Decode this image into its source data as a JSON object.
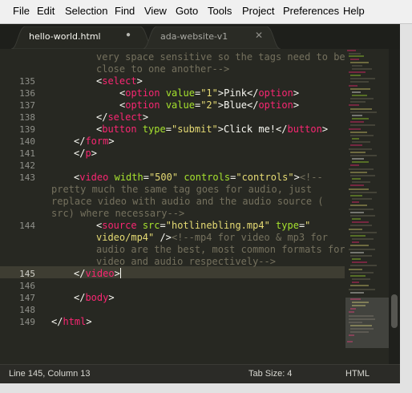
{
  "menu": [
    "File",
    "Edit",
    "Selection",
    "Find",
    "View",
    "Goto",
    "Tools",
    "Project",
    "Preferences",
    "Help"
  ],
  "tabs": [
    {
      "label": "hello-world.html",
      "state": "modified-dot"
    },
    {
      "label": "ada-website-v1",
      "state": "close-icon"
    }
  ],
  "tab_controls": {
    "modified": "●",
    "close": "✕"
  },
  "line_numbers": [
    "",
    "",
    "135",
    "136",
    "137",
    "138",
    "139",
    "140",
    "141",
    "142",
    "143",
    "",
    "",
    "",
    "144",
    "",
    "",
    "",
    "145",
    "146",
    "147",
    "148",
    "149"
  ],
  "code": [
    [
      {
        "c": "c",
        "x": "very space sensitive so the tags need to be"
      }
    ],
    [
      {
        "c": "c",
        "x": "close to one another-->"
      }
    ],
    [
      {
        "c": "p",
        "x": "<"
      },
      {
        "c": "t",
        "x": "select"
      },
      {
        "c": "p",
        "x": ">"
      }
    ],
    [
      {
        "c": "p",
        "x": "<"
      },
      {
        "c": "t",
        "x": "option"
      },
      {
        "c": "p",
        "x": " "
      },
      {
        "c": "a",
        "x": "value"
      },
      {
        "c": "p",
        "x": "="
      },
      {
        "c": "s",
        "x": "\"1\""
      },
      {
        "c": "p",
        "x": ">Pink</"
      },
      {
        "c": "t",
        "x": "option"
      },
      {
        "c": "p",
        "x": ">"
      }
    ],
    [
      {
        "c": "p",
        "x": "<"
      },
      {
        "c": "t",
        "x": "option"
      },
      {
        "c": "p",
        "x": " "
      },
      {
        "c": "a",
        "x": "value"
      },
      {
        "c": "p",
        "x": "="
      },
      {
        "c": "s",
        "x": "\"2\""
      },
      {
        "c": "p",
        "x": ">Blue</"
      },
      {
        "c": "t",
        "x": "option"
      },
      {
        "c": "p",
        "x": ">"
      }
    ],
    [
      {
        "c": "p",
        "x": "</"
      },
      {
        "c": "t",
        "x": "select"
      },
      {
        "c": "p",
        "x": ">"
      }
    ],
    [
      {
        "c": "p",
        "x": "<"
      },
      {
        "c": "t",
        "x": "button"
      },
      {
        "c": "p",
        "x": " "
      },
      {
        "c": "a",
        "x": "type"
      },
      {
        "c": "p",
        "x": "="
      },
      {
        "c": "s",
        "x": "\"submit\""
      },
      {
        "c": "p",
        "x": ">Click me!</"
      },
      {
        "c": "t",
        "x": "button"
      },
      {
        "c": "p",
        "x": ">"
      }
    ],
    [
      {
        "c": "p",
        "x": "</"
      },
      {
        "c": "t",
        "x": "form"
      },
      {
        "c": "p",
        "x": ">"
      }
    ],
    [
      {
        "c": "p",
        "x": "</"
      },
      {
        "c": "t",
        "x": "p"
      },
      {
        "c": "p",
        "x": ">"
      }
    ],
    [],
    [
      {
        "c": "p",
        "x": "<"
      },
      {
        "c": "t",
        "x": "video"
      },
      {
        "c": "p",
        "x": " "
      },
      {
        "c": "a",
        "x": "width"
      },
      {
        "c": "p",
        "x": "="
      },
      {
        "c": "s",
        "x": "\"500\""
      },
      {
        "c": "p",
        "x": " "
      },
      {
        "c": "a",
        "x": "controls"
      },
      {
        "c": "p",
        "x": "="
      },
      {
        "c": "s",
        "x": "\"controls\""
      },
      {
        "c": "p",
        "x": ">"
      },
      {
        "c": "c",
        "x": "<!--"
      }
    ],
    [
      {
        "c": "c",
        "x": "pretty much the same tag goes for audio, just"
      }
    ],
    [
      {
        "c": "c",
        "x": "replace video with audio and the audio source ("
      }
    ],
    [
      {
        "c": "c",
        "x": "src) where necessary-->"
      }
    ],
    [
      {
        "c": "p",
        "x": "<"
      },
      {
        "c": "t",
        "x": "source"
      },
      {
        "c": "p",
        "x": " "
      },
      {
        "c": "a",
        "x": "src"
      },
      {
        "c": "p",
        "x": "="
      },
      {
        "c": "s",
        "x": "\"hotlinebling.mp4\""
      },
      {
        "c": "p",
        "x": " "
      },
      {
        "c": "a",
        "x": "type"
      },
      {
        "c": "p",
        "x": "="
      },
      {
        "c": "s",
        "x": "\""
      }
    ],
    [
      {
        "c": "s",
        "x": "video/mp4\""
      },
      {
        "c": "p",
        "x": " />"
      },
      {
        "c": "c",
        "x": "<!--mp4 for video & mp3 for"
      }
    ],
    [
      {
        "c": "c",
        "x": "audio are the best, most common formats for"
      }
    ],
    [
      {
        "c": "c",
        "x": "video and audio respectively-->"
      }
    ],
    [
      {
        "c": "p",
        "x": "</"
      },
      {
        "c": "t",
        "x": "video"
      },
      {
        "c": "p",
        "x": ">"
      }
    ],
    [],
    [
      {
        "c": "p",
        "x": "</"
      },
      {
        "c": "t",
        "x": "body"
      },
      {
        "c": "p",
        "x": ">"
      }
    ],
    [],
    [
      {
        "c": "p",
        "x": "</"
      },
      {
        "c": "t",
        "x": "html"
      },
      {
        "c": "p",
        "x": ">"
      }
    ]
  ],
  "status": {
    "position": "Line 145, Column 13",
    "tab_size": "Tab Size: 4",
    "syntax": "HTML"
  }
}
